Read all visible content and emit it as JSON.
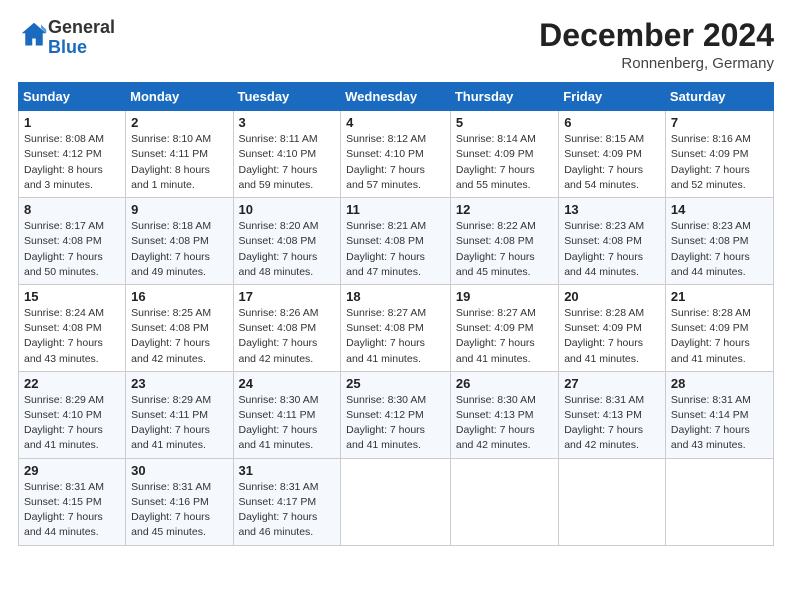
{
  "header": {
    "logo_general": "General",
    "logo_blue": "Blue",
    "month": "December 2024",
    "location": "Ronnenberg, Germany"
  },
  "weekdays": [
    "Sunday",
    "Monday",
    "Tuesday",
    "Wednesday",
    "Thursday",
    "Friday",
    "Saturday"
  ],
  "weeks": [
    [
      {
        "day": "1",
        "sunrise": "Sunrise: 8:08 AM",
        "sunset": "Sunset: 4:12 PM",
        "daylight": "Daylight: 8 hours and 3 minutes."
      },
      {
        "day": "2",
        "sunrise": "Sunrise: 8:10 AM",
        "sunset": "Sunset: 4:11 PM",
        "daylight": "Daylight: 8 hours and 1 minute."
      },
      {
        "day": "3",
        "sunrise": "Sunrise: 8:11 AM",
        "sunset": "Sunset: 4:10 PM",
        "daylight": "Daylight: 7 hours and 59 minutes."
      },
      {
        "day": "4",
        "sunrise": "Sunrise: 8:12 AM",
        "sunset": "Sunset: 4:10 PM",
        "daylight": "Daylight: 7 hours and 57 minutes."
      },
      {
        "day": "5",
        "sunrise": "Sunrise: 8:14 AM",
        "sunset": "Sunset: 4:09 PM",
        "daylight": "Daylight: 7 hours and 55 minutes."
      },
      {
        "day": "6",
        "sunrise": "Sunrise: 8:15 AM",
        "sunset": "Sunset: 4:09 PM",
        "daylight": "Daylight: 7 hours and 54 minutes."
      },
      {
        "day": "7",
        "sunrise": "Sunrise: 8:16 AM",
        "sunset": "Sunset: 4:09 PM",
        "daylight": "Daylight: 7 hours and 52 minutes."
      }
    ],
    [
      {
        "day": "8",
        "sunrise": "Sunrise: 8:17 AM",
        "sunset": "Sunset: 4:08 PM",
        "daylight": "Daylight: 7 hours and 50 minutes."
      },
      {
        "day": "9",
        "sunrise": "Sunrise: 8:18 AM",
        "sunset": "Sunset: 4:08 PM",
        "daylight": "Daylight: 7 hours and 49 minutes."
      },
      {
        "day": "10",
        "sunrise": "Sunrise: 8:20 AM",
        "sunset": "Sunset: 4:08 PM",
        "daylight": "Daylight: 7 hours and 48 minutes."
      },
      {
        "day": "11",
        "sunrise": "Sunrise: 8:21 AM",
        "sunset": "Sunset: 4:08 PM",
        "daylight": "Daylight: 7 hours and 47 minutes."
      },
      {
        "day": "12",
        "sunrise": "Sunrise: 8:22 AM",
        "sunset": "Sunset: 4:08 PM",
        "daylight": "Daylight: 7 hours and 45 minutes."
      },
      {
        "day": "13",
        "sunrise": "Sunrise: 8:23 AM",
        "sunset": "Sunset: 4:08 PM",
        "daylight": "Daylight: 7 hours and 44 minutes."
      },
      {
        "day": "14",
        "sunrise": "Sunrise: 8:23 AM",
        "sunset": "Sunset: 4:08 PM",
        "daylight": "Daylight: 7 hours and 44 minutes."
      }
    ],
    [
      {
        "day": "15",
        "sunrise": "Sunrise: 8:24 AM",
        "sunset": "Sunset: 4:08 PM",
        "daylight": "Daylight: 7 hours and 43 minutes."
      },
      {
        "day": "16",
        "sunrise": "Sunrise: 8:25 AM",
        "sunset": "Sunset: 4:08 PM",
        "daylight": "Daylight: 7 hours and 42 minutes."
      },
      {
        "day": "17",
        "sunrise": "Sunrise: 8:26 AM",
        "sunset": "Sunset: 4:08 PM",
        "daylight": "Daylight: 7 hours and 42 minutes."
      },
      {
        "day": "18",
        "sunrise": "Sunrise: 8:27 AM",
        "sunset": "Sunset: 4:08 PM",
        "daylight": "Daylight: 7 hours and 41 minutes."
      },
      {
        "day": "19",
        "sunrise": "Sunrise: 8:27 AM",
        "sunset": "Sunset: 4:09 PM",
        "daylight": "Daylight: 7 hours and 41 minutes."
      },
      {
        "day": "20",
        "sunrise": "Sunrise: 8:28 AM",
        "sunset": "Sunset: 4:09 PM",
        "daylight": "Daylight: 7 hours and 41 minutes."
      },
      {
        "day": "21",
        "sunrise": "Sunrise: 8:28 AM",
        "sunset": "Sunset: 4:09 PM",
        "daylight": "Daylight: 7 hours and 41 minutes."
      }
    ],
    [
      {
        "day": "22",
        "sunrise": "Sunrise: 8:29 AM",
        "sunset": "Sunset: 4:10 PM",
        "daylight": "Daylight: 7 hours and 41 minutes."
      },
      {
        "day": "23",
        "sunrise": "Sunrise: 8:29 AM",
        "sunset": "Sunset: 4:11 PM",
        "daylight": "Daylight: 7 hours and 41 minutes."
      },
      {
        "day": "24",
        "sunrise": "Sunrise: 8:30 AM",
        "sunset": "Sunset: 4:11 PM",
        "daylight": "Daylight: 7 hours and 41 minutes."
      },
      {
        "day": "25",
        "sunrise": "Sunrise: 8:30 AM",
        "sunset": "Sunset: 4:12 PM",
        "daylight": "Daylight: 7 hours and 41 minutes."
      },
      {
        "day": "26",
        "sunrise": "Sunrise: 8:30 AM",
        "sunset": "Sunset: 4:13 PM",
        "daylight": "Daylight: 7 hours and 42 minutes."
      },
      {
        "day": "27",
        "sunrise": "Sunrise: 8:31 AM",
        "sunset": "Sunset: 4:13 PM",
        "daylight": "Daylight: 7 hours and 42 minutes."
      },
      {
        "day": "28",
        "sunrise": "Sunrise: 8:31 AM",
        "sunset": "Sunset: 4:14 PM",
        "daylight": "Daylight: 7 hours and 43 minutes."
      }
    ],
    [
      {
        "day": "29",
        "sunrise": "Sunrise: 8:31 AM",
        "sunset": "Sunset: 4:15 PM",
        "daylight": "Daylight: 7 hours and 44 minutes."
      },
      {
        "day": "30",
        "sunrise": "Sunrise: 8:31 AM",
        "sunset": "Sunset: 4:16 PM",
        "daylight": "Daylight: 7 hours and 45 minutes."
      },
      {
        "day": "31",
        "sunrise": "Sunrise: 8:31 AM",
        "sunset": "Sunset: 4:17 PM",
        "daylight": "Daylight: 7 hours and 46 minutes."
      },
      null,
      null,
      null,
      null
    ]
  ]
}
